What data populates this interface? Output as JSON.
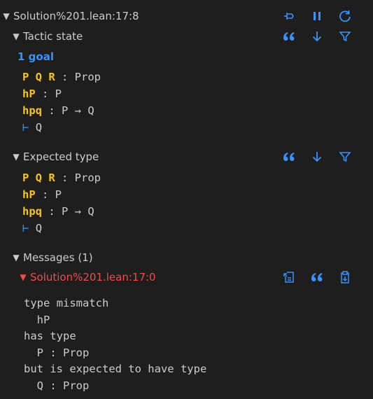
{
  "header": {
    "location": "Solution%201.lean:17:8"
  },
  "tactic_state": {
    "title": "Tactic state",
    "goal_count": "1 goal",
    "hyps": [
      {
        "names": "P Q R",
        "type": "Prop"
      },
      {
        "names": "hP",
        "type": "P"
      },
      {
        "names": "hpq",
        "type": "P → Q"
      }
    ],
    "turnstile": "⊢",
    "goal": "Q"
  },
  "expected_type": {
    "title": "Expected type",
    "hyps": [
      {
        "names": "P Q R",
        "type": "Prop"
      },
      {
        "names": "hP",
        "type": "P"
      },
      {
        "names": "hpq",
        "type": "P → Q"
      }
    ],
    "turnstile": "⊢",
    "goal": "Q"
  },
  "messages": {
    "title": "Messages (1)",
    "item_location": "Solution%201.lean:17:0",
    "lines": [
      "type mismatch",
      "  hP",
      "has type",
      "  P : Prop",
      "but is expected to have type",
      "  Q : Prop"
    ]
  },
  "icons": [
    "pin-icon",
    "pause-icon",
    "refresh-icon",
    "quote-icon",
    "arrow-down-icon",
    "filter-icon",
    "copy-to-comment-icon",
    "copy-icon"
  ],
  "colors": {
    "accent": "#3794ff",
    "hyp_name": "#f5c518",
    "error": "#f14c4c",
    "background": "#1e1e1e"
  }
}
